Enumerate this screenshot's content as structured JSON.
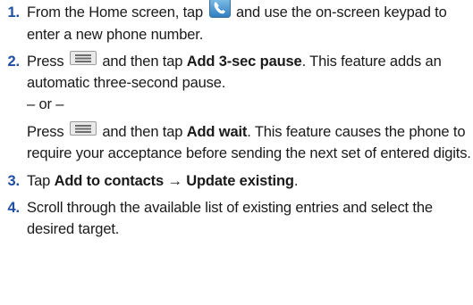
{
  "steps": [
    {
      "number": "1.",
      "before": "From the Home screen, tap",
      "icon": "phone-icon",
      "after": "and use the on-screen keypad to enter a new phone number."
    },
    {
      "number": "2.",
      "press": "Press",
      "icon": "menu-icon",
      "then_tap": "and then tap",
      "action": "Add 3-sec pause",
      "after": ". This feature adds an automatic three-second pause.",
      "or_text": "– or –",
      "alt_press": "Press",
      "alt_then_tap": "and then tap",
      "alt_action": "Add wait",
      "alt_after": ". This feature causes the phone to require your acceptance before sending the next set of entered digits."
    },
    {
      "number": "3.",
      "tap": "Tap",
      "action": "Add to contacts → Update existing",
      "after": "."
    },
    {
      "number": "4.",
      "text": "Scroll through the available list of existing entries and select the desired target."
    }
  ]
}
